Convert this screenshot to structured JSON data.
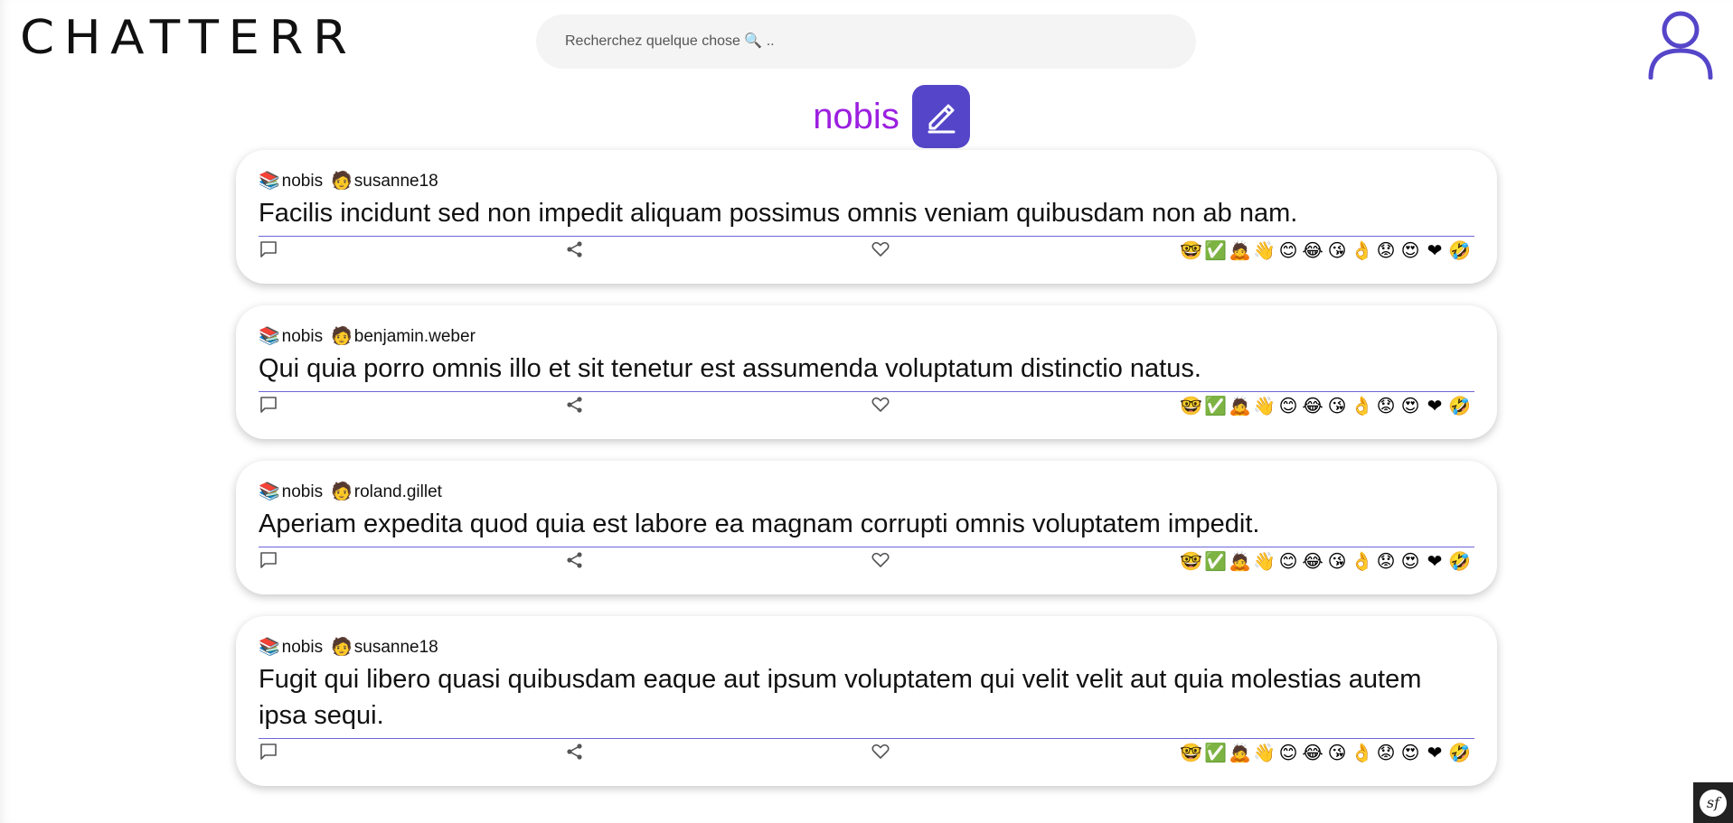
{
  "app": {
    "logo": "CHATTERR",
    "search": {
      "placeholder": "Recherchez quelque chose 🔍 ..",
      "value": ""
    }
  },
  "page": {
    "title": "nobis"
  },
  "reactions": [
    "🤓",
    "✅",
    "🙇",
    "👋",
    "😊",
    "😂",
    "😘",
    "👌",
    "😟",
    "😍",
    "❤",
    "🤣"
  ],
  "posts": [
    {
      "author": "nobis",
      "recipient": "susanne18",
      "body": "Facilis incidunt sed non impedit aliquam possimus omnis veniam quibusdam non ab nam."
    },
    {
      "author": "nobis",
      "recipient": "benjamin.weber",
      "body": "Qui quia porro omnis illo et sit tenetur est assumenda voluptatum distinctio natus."
    },
    {
      "author": "nobis",
      "recipient": "roland.gillet",
      "body": "Aperiam expedita quod quia est labore ea magnam corrupti omnis voluptatem impedit."
    },
    {
      "author": "nobis",
      "recipient": "susanne18",
      "body": "Fugit qui libero quasi quibusdam eaque aut ipsum voluptatem qui velit velit aut quia molestias autem ipsa sequi."
    }
  ],
  "icons": {
    "user": "user-profile-icon",
    "edit": "pencil-edit-icon",
    "comment": "comment-icon",
    "share": "share-icon",
    "like": "heart-icon",
    "author_glyph": "books-icon",
    "recipient_glyph": "person-icon",
    "debug": "symfony-toolbar-icon"
  },
  "colors": {
    "accent": "#5546c9",
    "title": "#9b1fe0",
    "divider": "#6d66d8"
  }
}
